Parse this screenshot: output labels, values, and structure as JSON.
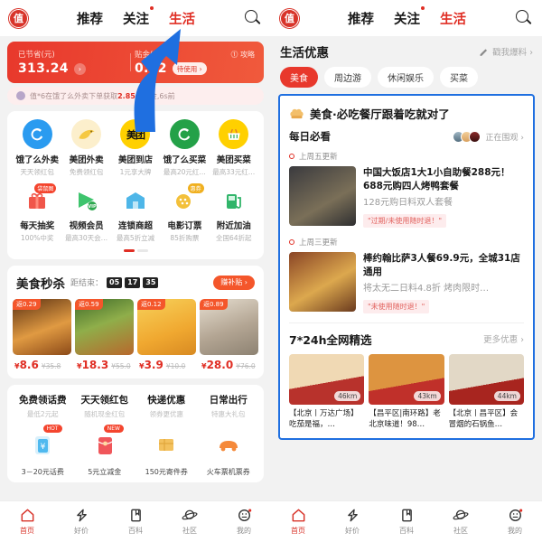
{
  "brand": {
    "logo_text": "值",
    "accent_red": "#e02e24",
    "annotation_blue": "#1f6fe0"
  },
  "nav": {
    "tabs": [
      {
        "label": "推荐",
        "active": false,
        "dot": false
      },
      {
        "label": "关注",
        "active": false,
        "dot": true
      },
      {
        "label": "生活",
        "active": true,
        "dot": false
      }
    ],
    "search_icon": "search-icon"
  },
  "left": {
    "banner": {
      "saved_label": "已节省(元)",
      "saved_value": "313.24",
      "saved_arrow": "›",
      "subsidy_label": "贴金(元)",
      "subsidy_value": "0.92",
      "subsidy_pill": "待使用 ›",
      "guide": "⓵ 攻略"
    },
    "ticker": {
      "prefix": "值*6在饿了么外卖下单获取",
      "amount": "2.85元",
      "suffix": "现金,6s前"
    },
    "icons_row1": [
      {
        "name": "饿了么外卖",
        "sub": "天天领红包",
        "glyph": "e",
        "bg": "#2a9bf0",
        "badge": ""
      },
      {
        "name": "美团外卖",
        "sub": "免费领红包",
        "glyph": "🦘",
        "bg": "#fbe3a6",
        "badge": ""
      },
      {
        "name": "美团到店",
        "sub": "1元享大牌",
        "glyph": "美团",
        "bg": "#ffd000",
        "badge": ""
      },
      {
        "name": "饿了么买菜",
        "sub": "最高20元红…",
        "glyph": "e",
        "bg": "#24a148",
        "badge": ""
      },
      {
        "name": "美团买菜",
        "sub": "最高33元红…",
        "glyph": "🧺",
        "bg": "#ffd000",
        "badge": ""
      }
    ],
    "icons_row2": [
      {
        "name": "每天抽奖",
        "sub": "100%中奖",
        "glyph": "🎁",
        "bg": "transparent",
        "badge": "袋鼠图"
      },
      {
        "name": "视频会员",
        "sub": "最高30天会…",
        "glyph": "▶",
        "bg": "transparent",
        "badge": ""
      },
      {
        "name": "连锁商超",
        "sub": "最高5折立减",
        "glyph": "🏠",
        "bg": "transparent",
        "badge": ""
      },
      {
        "name": "电影订票",
        "sub": "85折购票",
        "glyph": "🎟",
        "bg": "transparent",
        "badge": "惠券"
      },
      {
        "name": "附近加油",
        "sub": "全国64折起",
        "glyph": "⛽",
        "bg": "transparent",
        "badge": ""
      }
    ],
    "flash": {
      "title": "美食秒杀",
      "countdown_label": "距结束：",
      "countdown": [
        "05",
        "17",
        "35"
      ],
      "action": "赚补贴 ›",
      "items": [
        {
          "rebate": "返0.29",
          "price": "8.6",
          "old": "¥35.8",
          "img_a": "#b5501f",
          "img_b": "#f0a24a"
        },
        {
          "rebate": "返0.59",
          "price": "18.3",
          "old": "¥55.0",
          "img_a": "#3f6b2a",
          "img_b": "#c1762c"
        },
        {
          "rebate": "返0.12",
          "price": "3.9",
          "old": "¥10.0",
          "img_a": "#f7c948",
          "img_b": "#d8912b"
        },
        {
          "rebate": "返0.89",
          "price": "28.0",
          "old": "¥76.0",
          "img_a": "#cfc4b4",
          "img_b": "#9c8f7e"
        }
      ]
    },
    "promos": [
      {
        "title": "免费领话费",
        "sub": "最低2元起",
        "badge": "HOT",
        "caption": "3－20元话费",
        "color": "#5ec5f5"
      },
      {
        "title": "天天领红包",
        "sub": "随机现金红包",
        "badge": "NEW",
        "caption": "5元立减金",
        "color": "#f05a5a"
      },
      {
        "title": "快递优惠",
        "sub": "领券更优惠",
        "badge": "",
        "caption": "150元寄件券",
        "color": "#f0b85e"
      },
      {
        "title": "日常出行",
        "sub": "特惠大礼包",
        "badge": "",
        "caption": "火车票机票券",
        "color": "#f58a2e"
      }
    ]
  },
  "right": {
    "section": {
      "title": "生活优惠",
      "link": "戳我爆料 ›",
      "pencil_icon": "pencil-icon"
    },
    "chips": [
      {
        "label": "美食",
        "active": true
      },
      {
        "label": "周边游",
        "active": false
      },
      {
        "label": "休闲娱乐",
        "active": false
      },
      {
        "label": "买菜",
        "active": false
      }
    ],
    "must_eat": {
      "icon": "hat-icon",
      "title": "美食·必吃餐厅跟着吃就对了"
    },
    "daily": {
      "title": "每日必看",
      "watch_label": "正在围观 ›"
    },
    "deals": [
      {
        "update": "上周五更新",
        "title": "中国大饭店1大1小自助餐288元！688元购四人烤鸭套餐",
        "subtitle": "128元购日料双人套餐",
        "tag": "\"过期/未使用随时退！\"",
        "img_a": "#2f2f33",
        "img_b": "#6d6450"
      },
      {
        "update": "上周三更新",
        "title": "棒约翰比萨3人餐69.9元，全城31店通用",
        "subtitle": "将太无二日料4.8折 烤肉限时…",
        "tag": "\"未使用随时退！\"",
        "img_a": "#7a3d24",
        "img_b": "#d8a24a"
      }
    ],
    "picks": {
      "title": "7*24h全网精选",
      "link": "更多优惠 ›",
      "items": [
        {
          "distance": "46km",
          "title": "【北京丨万达广场】吃茄是福，…",
          "img_a": "#e8c9a0",
          "img_b": "#b8322c"
        },
        {
          "distance": "43km",
          "title": "【昌平区|南环路】老北京味道！98…",
          "img_a": "#d8872c",
          "img_b": "#c0302a"
        },
        {
          "distance": "44km",
          "title": "【北京丨昌平区】会冒烟的石锅鱼…",
          "img_a": "#ddd3c2",
          "img_b": "#a8251f"
        }
      ]
    }
  },
  "tabbar": [
    {
      "label": "首页",
      "icon": "home-icon",
      "active": true,
      "dot": false
    },
    {
      "label": "好价",
      "icon": "tag-icon",
      "active": false,
      "dot": false
    },
    {
      "label": "百科",
      "icon": "book-icon",
      "active": false,
      "dot": false
    },
    {
      "label": "社区",
      "icon": "planet-icon",
      "active": false,
      "dot": false
    },
    {
      "label": "我的",
      "icon": "profile-icon",
      "active": false,
      "dot": true
    }
  ]
}
